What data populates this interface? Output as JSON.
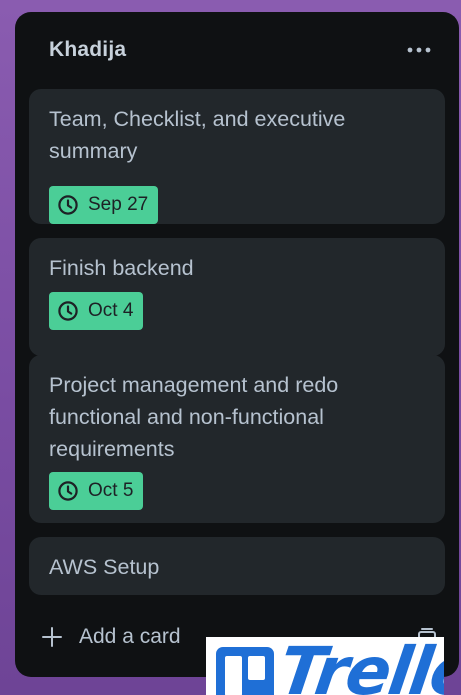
{
  "list": {
    "title": "Khadija"
  },
  "cards": [
    {
      "title": "Team, Checklist, and executive summary",
      "due": "Sep 27"
    },
    {
      "title": "Finish backend",
      "due": "Oct 4"
    },
    {
      "title": "Project management and redo functional and non-functional requirements",
      "due": "Oct 5"
    },
    {
      "title": "AWS Setup"
    }
  ],
  "footer": {
    "add_card_label": "Add a card"
  },
  "logo": {
    "word": "Trello"
  },
  "colors": {
    "board_bg": "#7c4fa6",
    "list_bg": "#0f1113",
    "card_bg": "#22272b",
    "text": "#b6c2cf",
    "badge_green": "#4bce97",
    "logo_blue": "#1f6fd6"
  },
  "icons": {
    "more": "ellipsis-icon",
    "due": "clock-icon",
    "add": "plus-icon",
    "template": "card-template-icon",
    "logo": "trello-board-icon"
  }
}
